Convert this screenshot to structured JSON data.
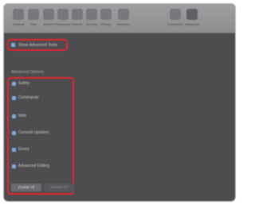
{
  "toolbar": {
    "items": [
      {
        "label": "General",
        "icon": "switch-icon"
      },
      {
        "label": "Tabs",
        "icon": "tabs-icon"
      },
      {
        "label": "AutoFill",
        "icon": "pencil-icon"
      },
      {
        "label": "Passwords",
        "icon": "key-icon"
      },
      {
        "label": "Search",
        "icon": "magnifier-icon"
      },
      {
        "label": "Security",
        "icon": "lock-icon"
      },
      {
        "label": "Privacy",
        "icon": "hand-icon"
      },
      {
        "label": "Websites",
        "icon": "globe-icon"
      },
      {
        "label": "Extensions",
        "icon": "puzzle-icon"
      },
      {
        "label": "Advanced",
        "icon": "gear-icon"
      }
    ]
  },
  "main": {
    "master_toggle": {
      "label": "Show Advanced Tools",
      "checked": true
    },
    "intro_line_1": "",
    "intro_line_2": "",
    "section_heading": "Advanced Options",
    "options": [
      {
        "title": "Safety",
        "checked": true,
        "desc": ""
      },
      {
        "title": "Commands",
        "checked": true,
        "desc": ""
      },
      {
        "title": "Web",
        "checked": true,
        "desc": ""
      },
      {
        "title": "Console Updates",
        "checked": true,
        "desc": ""
      },
      {
        "title": "Errors",
        "checked": true,
        "desc": ""
      },
      {
        "title": "Advanced Editing",
        "checked": true,
        "desc": "",
        "desc2": ""
      }
    ],
    "buttons": {
      "primary": "Enable All",
      "secondary": "Disable All"
    }
  },
  "colors": {
    "highlight": "#e1262c",
    "checkbox_on": "#7fa9df",
    "background": "#4d4d4f"
  }
}
